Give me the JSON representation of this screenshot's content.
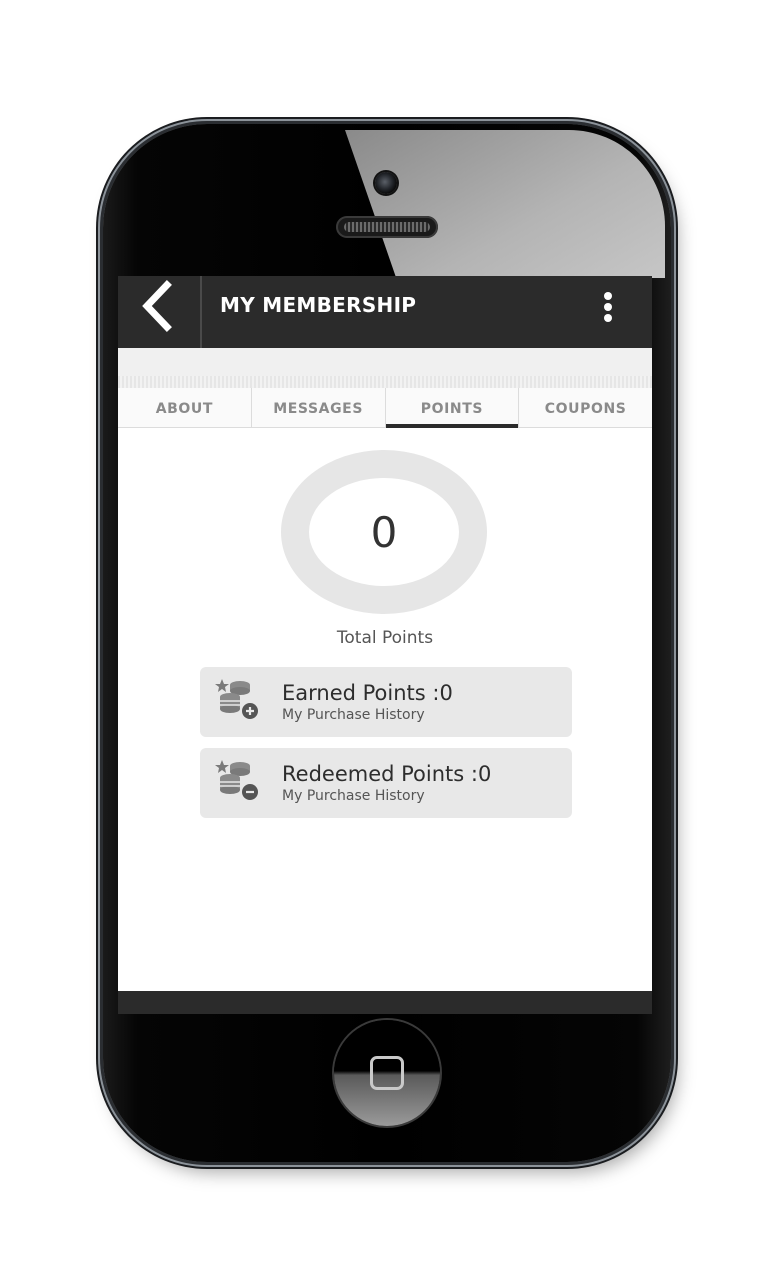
{
  "header": {
    "title": "MY MEMBERSHIP"
  },
  "tabs": [
    {
      "label": "ABOUT"
    },
    {
      "label": "MESSAGES"
    },
    {
      "label": "POINTS",
      "active": true
    },
    {
      "label": "COUPONS"
    }
  ],
  "points": {
    "total_value": "0",
    "total_label": "Total Points"
  },
  "cards": [
    {
      "title": "Earned Points :0",
      "subtitle": "My Purchase History",
      "icon": "coins-plus-icon"
    },
    {
      "title": "Redeemed Points :0",
      "subtitle": "My Purchase History",
      "icon": "coins-minus-icon"
    }
  ],
  "colors": {
    "topbar": "#2b2b2b",
    "ring": "#e6e6e6",
    "card": "#e8e8e8"
  }
}
